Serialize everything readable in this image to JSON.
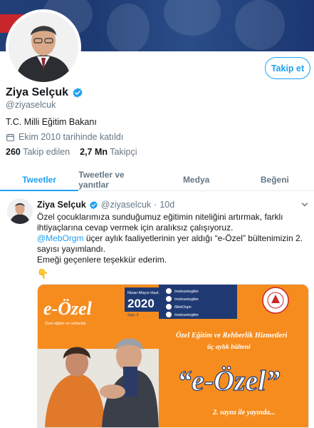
{
  "profile": {
    "name": "Ziya Selçuk",
    "handle": "@ziyaselcuk",
    "bio": "T.C. Milli Eğitim Bakanı",
    "joined": "Ekim 2010 tarihinde katıldı",
    "following_count": "260",
    "following_label": "Takip edilen",
    "followers_count": "2,7 Mn",
    "followers_label": "Takipçi",
    "follow_button": "Takip et"
  },
  "tabs": [
    {
      "label": "Tweetler",
      "active": true
    },
    {
      "label": "Tweetler ve yanıtlar",
      "active": false
    },
    {
      "label": "Medya",
      "active": false
    },
    {
      "label": "Beğeni",
      "active": false
    }
  ],
  "tweet": {
    "name": "Ziya Selçuk",
    "handle": "@ziyaselcuk",
    "sep": "·",
    "time": "10d",
    "line1": "Özel çocuklarımıza sunduğumuz eğitimin niteliğini artırmak, farklı ihtiyaçlarına cevap vermek için aralıksız çalışıyoruz.",
    "mention": "@MebOrgm",
    "line2_rest": " üçer aylık faaliyetlerinin yer aldığı “e-Özel” bültenimizin 2. sayısı yayımlandı.",
    "line3": "Emeği geçenlere teşekkür ederim.",
    "emoji": "👇"
  },
  "bulletin": {
    "brand": "e-Özel",
    "brand_sub": "Özel eğitim ve rehberlik",
    "date_label": "Nisan-Mayıs-Haziran",
    "year": "2020",
    "sayi": "Sayı: 2",
    "social": [
      "/mebozelegitim",
      "/mebozelegitim",
      "/MebOrgm",
      "/mebozelegitim"
    ],
    "headline1": "Özel Eğitim ve Rehberlik Hizmetleri",
    "headline2": "üç aylık bülteni",
    "big_title": "“e-Özel”",
    "footer": "2. sayısı ile yayında..."
  },
  "colors": {
    "accent": "#1da1f2",
    "orange": "#f68c1e",
    "navy": "#1f3a73"
  }
}
